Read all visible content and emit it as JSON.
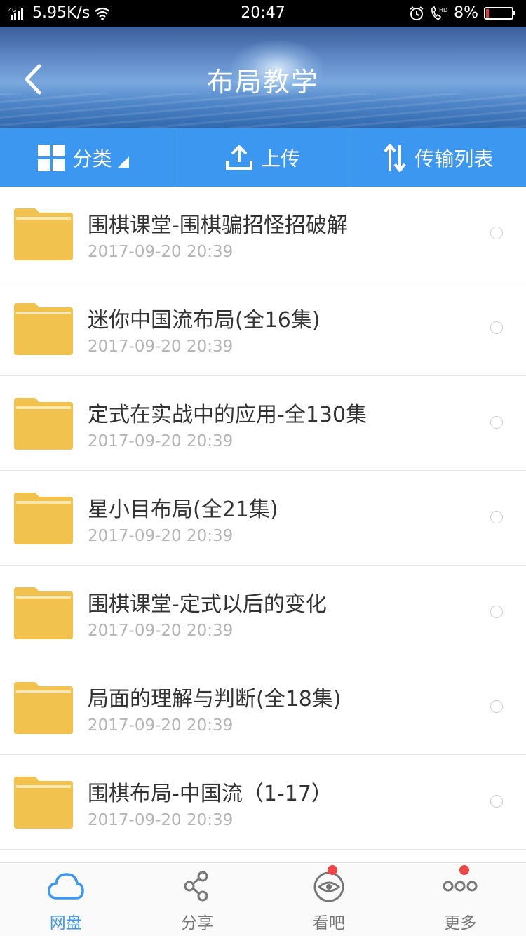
{
  "status_bar": {
    "network_type": "4G",
    "speed": "5.95K/s",
    "time": "20:47",
    "call_badge": "HD",
    "battery": "8%"
  },
  "header": {
    "title": "布局教学",
    "back_icon": "chevron-left-icon"
  },
  "toolbar": {
    "items": [
      {
        "label": "分类",
        "icon": "grid-icon"
      },
      {
        "label": "上传",
        "icon": "upload-icon"
      },
      {
        "label": "传输列表",
        "icon": "transfer-icon"
      }
    ]
  },
  "files": [
    {
      "name": "围棋课堂-围棋骗招怪招破解",
      "date": "2017-09-20  20:39"
    },
    {
      "name": "迷你中国流布局(全16集)",
      "date": "2017-09-20  20:39"
    },
    {
      "name": "定式在实战中的应用-全130集",
      "date": "2017-09-20  20:39"
    },
    {
      "name": "星小目布局(全21集)",
      "date": "2017-09-20  20:39"
    },
    {
      "name": "围棋课堂-定式以后的变化",
      "date": "2017-09-20  20:39"
    },
    {
      "name": "局面的理解与判断(全18集)",
      "date": "2017-09-20  20:39"
    },
    {
      "name": "围棋布局-中国流（1-17）",
      "date": "2017-09-20  20:39"
    }
  ],
  "tabs": [
    {
      "label": "网盘",
      "icon": "cloud-icon",
      "active": true
    },
    {
      "label": "分享",
      "icon": "share-icon"
    },
    {
      "label": "看吧",
      "icon": "eye-icon",
      "badge": true
    },
    {
      "label": "更多",
      "icon": "more-icon",
      "badge": true
    }
  ],
  "colors": {
    "accent": "#3c97f0",
    "folder": "#f2c24f",
    "badge": "#ee4444"
  }
}
